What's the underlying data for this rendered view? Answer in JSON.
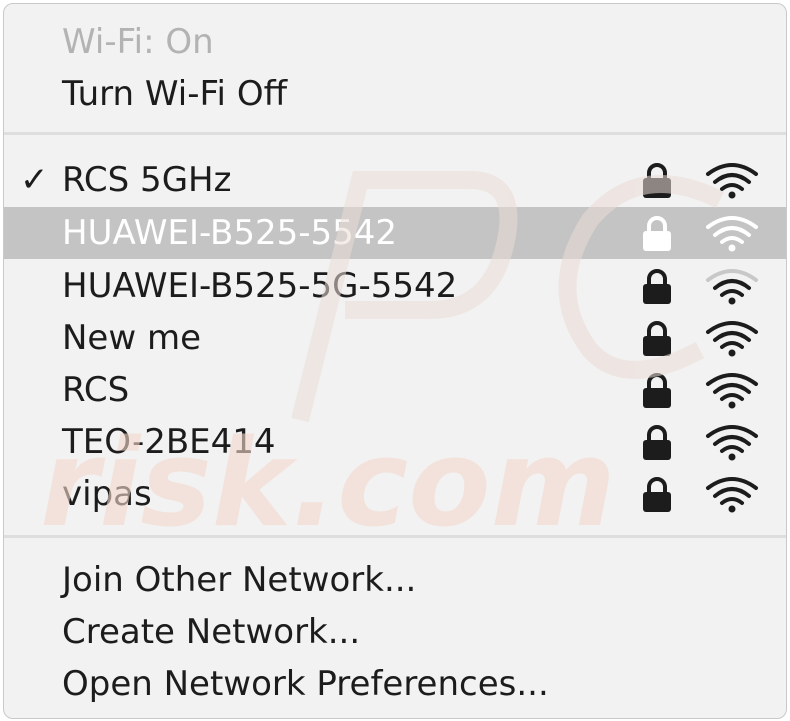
{
  "menu": {
    "status_label": "Wi-Fi: On",
    "toggle_label": "Turn Wi-Fi Off",
    "check_glyph": "✓",
    "networks": [
      {
        "name": "RCS 5GHz",
        "connected": true,
        "secured": true,
        "signal_bars": 3,
        "highlighted": false
      },
      {
        "name": "HUAWEI-B525-5542",
        "connected": false,
        "secured": true,
        "signal_bars": 3,
        "highlighted": true
      },
      {
        "name": "HUAWEI-B525-5G-5542",
        "connected": false,
        "secured": true,
        "signal_bars": 2,
        "highlighted": false
      },
      {
        "name": "New me",
        "connected": false,
        "secured": true,
        "signal_bars": 3,
        "highlighted": false
      },
      {
        "name": "RCS",
        "connected": false,
        "secured": true,
        "signal_bars": 3,
        "highlighted": false
      },
      {
        "name": "TEO-2BE414",
        "connected": false,
        "secured": true,
        "signal_bars": 3,
        "highlighted": false
      },
      {
        "name": "vipas",
        "connected": false,
        "secured": true,
        "signal_bars": 3,
        "highlighted": false
      }
    ],
    "actions": {
      "join_other": "Join Other Network...",
      "create": "Create Network...",
      "preferences": "Open Network Preferences..."
    }
  },
  "icons": {
    "lock": "lock-icon",
    "wifi": "wifi-signal-icon",
    "check": "checkmark-icon"
  },
  "colors": {
    "menu_bg": "#f2f2f2",
    "text": "#1c1c1c",
    "disabled_text": "#b3b3b3",
    "highlight_bg": "#c4c4c4",
    "icon_dark": "#1c1c1c",
    "watermark": "pcrisk.com"
  }
}
